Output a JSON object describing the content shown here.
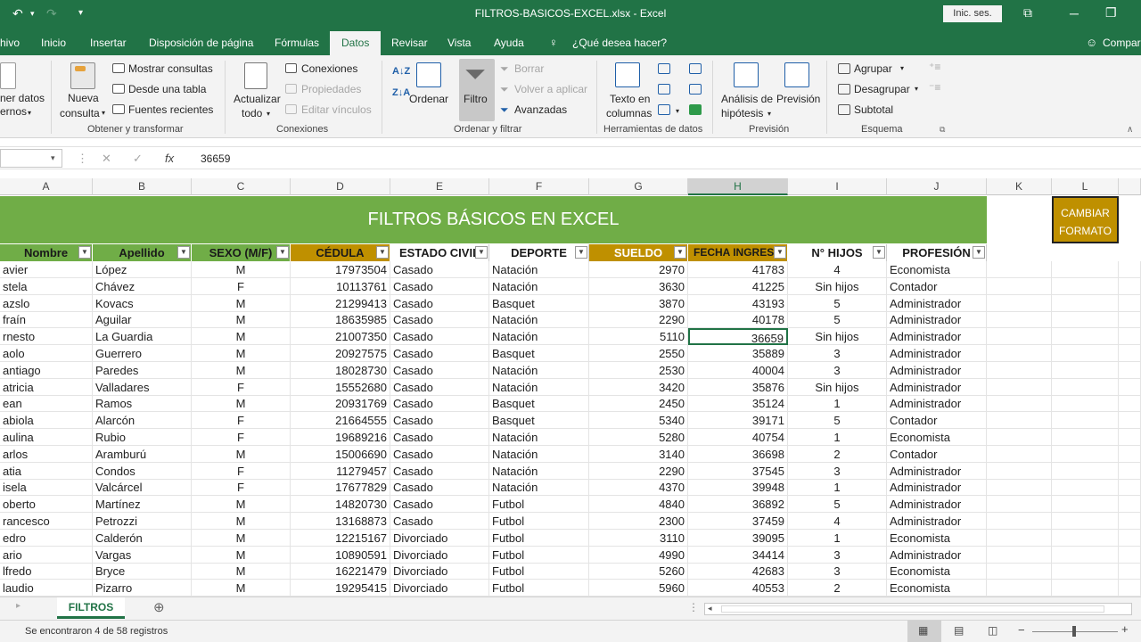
{
  "window": {
    "title": "FILTROS-BASICOS-EXCEL.xlsx  -  Excel",
    "signin": "Inic. ses."
  },
  "tabs": [
    "hivo",
    "Inicio",
    "Insertar",
    "Disposición de página",
    "Fórmulas",
    "Datos",
    "Revisar",
    "Vista",
    "Ayuda",
    "¿Qué desea hacer?",
    "Compar"
  ],
  "ribbon": {
    "get_data_1": "ner datos",
    "get_data_2": "ernos",
    "nueva_1": "Nueva",
    "nueva_2": "consulta",
    "mostrar": "Mostrar consultas",
    "desde_tabla": "Desde una tabla",
    "fuentes": "Fuentes recientes",
    "group1": "Obtener y transformar",
    "actualizar_1": "Actualizar",
    "actualizar_2": "todo",
    "conexiones": "Conexiones",
    "propiedades": "Propiedades",
    "editar": "Editar vínculos",
    "group2": "Conexiones",
    "ordenar": "Ordenar",
    "filtro": "Filtro",
    "borrar": "Borrar",
    "volver": "Volver a aplicar",
    "avanzadas": "Avanzadas",
    "group3": "Ordenar y filtrar",
    "texto_1": "Texto en",
    "texto_2": "columnas",
    "group4": "Herramientas de datos",
    "analisis_1": "Análisis de",
    "analisis_2": "hipótesis",
    "prevision": "Previsión",
    "group5": "Previsión",
    "agrupar": "Agrupar",
    "desagrupar": "Desagrupar",
    "subtotal": "Subtotal",
    "group6": "Esquema"
  },
  "formula": {
    "value": "36659"
  },
  "columns": [
    "A",
    "B",
    "C",
    "D",
    "E",
    "F",
    "G",
    "H",
    "I",
    "J",
    "K",
    "L"
  ],
  "banner": "FILTROS BÁSICOS EN EXCEL",
  "cambiar": "CAMBIAR FORMATO",
  "headers": [
    "Nombre",
    "Apellido",
    "SEXO (M/F)",
    "CÉDULA",
    "ESTADO CIVIL",
    "DEPORTE",
    "SUELDO",
    "FECHA INGRESO",
    "N° HIJOS",
    "PROFESIÓN"
  ],
  "rows": [
    [
      "avier",
      "López",
      "M",
      "17973504",
      "Casado",
      "Natación",
      "2970",
      "41783",
      "4",
      "Economista"
    ],
    [
      "stela",
      "Chávez",
      "F",
      "10113761",
      "Casado",
      "Natación",
      "3630",
      "41225",
      "Sin hijos",
      "Contador"
    ],
    [
      "azslo",
      "Kovacs",
      "M",
      "21299413",
      "Casado",
      "Basquet",
      "3870",
      "43193",
      "5",
      "Administrador"
    ],
    [
      "fraín",
      "Aguilar",
      "M",
      "18635985",
      "Casado",
      "Natación",
      "2290",
      "40178",
      "5",
      "Administrador"
    ],
    [
      "rnesto",
      "La Guardia",
      "M",
      "21007350",
      "Casado",
      "Natación",
      "5110",
      "36659",
      "Sin hijos",
      "Administrador"
    ],
    [
      "aolo",
      "Guerrero",
      "M",
      "20927575",
      "Casado",
      "Basquet",
      "2550",
      "35889",
      "3",
      "Administrador"
    ],
    [
      "antiago",
      "Paredes",
      "M",
      "18028730",
      "Casado",
      "Natación",
      "2530",
      "40004",
      "3",
      "Administrador"
    ],
    [
      "atricia",
      "Valladares",
      "F",
      "15552680",
      "Casado",
      "Natación",
      "3420",
      "35876",
      "Sin hijos",
      "Administrador"
    ],
    [
      "ean",
      "Ramos",
      "M",
      "20931769",
      "Casado",
      "Basquet",
      "2450",
      "35124",
      "1",
      "Administrador"
    ],
    [
      "abiola",
      "Alarcón",
      "F",
      "21664555",
      "Casado",
      "Basquet",
      "5340",
      "39171",
      "5",
      "Contador"
    ],
    [
      "aulina",
      "Rubio",
      "F",
      "19689216",
      "Casado",
      "Natación",
      "5280",
      "40754",
      "1",
      "Economista"
    ],
    [
      "arlos",
      "Aramburú",
      "M",
      "15006690",
      "Casado",
      "Natación",
      "3140",
      "36698",
      "2",
      "Contador"
    ],
    [
      "atia",
      "Condos",
      "F",
      "11279457",
      "Casado",
      "Natación",
      "2290",
      "37545",
      "3",
      "Administrador"
    ],
    [
      "isela",
      "Valcárcel",
      "F",
      "17677829",
      "Casado",
      "Natación",
      "4370",
      "39948",
      "1",
      "Administrador"
    ],
    [
      "oberto",
      "Martínez",
      "M",
      "14820730",
      "Casado",
      "Futbol",
      "4840",
      "36892",
      "5",
      "Administrador"
    ],
    [
      "rancesco",
      "Petrozzi",
      "M",
      "13168873",
      "Casado",
      "Futbol",
      "2300",
      "37459",
      "4",
      "Administrador"
    ],
    [
      "edro",
      "Calderón",
      "M",
      "12215167",
      "Divorciado",
      "Futbol",
      "3110",
      "39095",
      "1",
      "Economista"
    ],
    [
      "ario",
      "Vargas",
      "M",
      "10890591",
      "Divorciado",
      "Futbol",
      "4990",
      "34414",
      "3",
      "Administrador"
    ],
    [
      "lfredo",
      "Bryce",
      "M",
      "16221479",
      "Divorciado",
      "Futbol",
      "5260",
      "42683",
      "3",
      "Economista"
    ],
    [
      "laudio",
      "Pizarro",
      "M",
      "19295415",
      "Divorciado",
      "Futbol",
      "5960",
      "40553",
      "2",
      "Economista"
    ]
  ],
  "sheet": {
    "tab": "FILTROS"
  },
  "status": "Se encontraron 4 de 58 registros",
  "colors": {
    "excel_green": "#217346",
    "banner_green": "#70ad47",
    "gold": "#bf9000"
  }
}
